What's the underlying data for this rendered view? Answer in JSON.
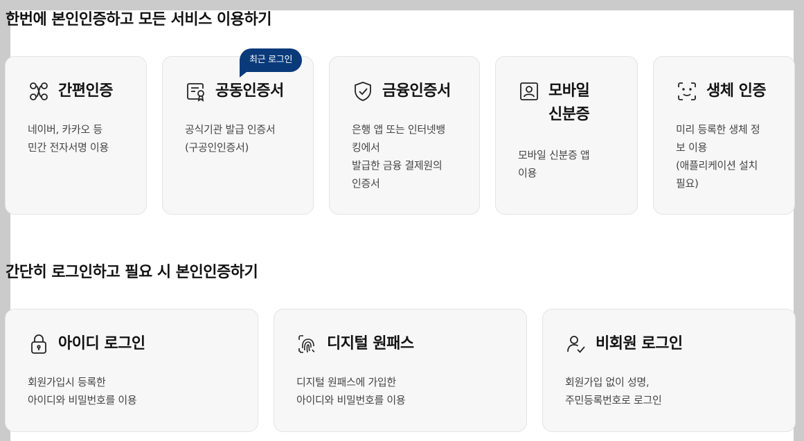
{
  "section1": {
    "title": "한번에 본인인증하고 모든 서비스 이용하기",
    "cards": [
      {
        "icon": "link-nodes-icon",
        "title_lines": [
          "간편인증"
        ],
        "desc": [
          "네이버, 카카오 등",
          "민간 전자서명 이용"
        ]
      },
      {
        "icon": "certificate-icon",
        "title_lines": [
          "공동인증서"
        ],
        "desc": [
          "공식기관 발급 인증서",
          "(구공인인증서)"
        ],
        "badge": "최근 로그인"
      },
      {
        "icon": "shield-check-icon",
        "title_lines": [
          "금융인증서"
        ],
        "desc": [
          "은행 앱 또는 인터넷뱅",
          "킹에서",
          "발급한 금융 결제원의",
          "인증서"
        ]
      },
      {
        "icon": "id-card-icon",
        "title_lines": [
          "모바일",
          "신분증"
        ],
        "desc": [
          "모바일 신분증 앱",
          "이용"
        ]
      },
      {
        "icon": "face-scan-icon",
        "title_lines": [
          "생체 인증"
        ],
        "desc": [
          "미리 등록한 생체 정",
          "보 이용",
          "(애플리케이션 설치",
          "필요)"
        ]
      }
    ]
  },
  "section2": {
    "title": "간단히 로그인하고 필요 시 본인인증하기",
    "cards": [
      {
        "icon": "lock-icon",
        "title_lines": [
          "아이디 로그인"
        ],
        "desc": [
          "회원가입시 등록한",
          "아이디와 비밀번호를 이용"
        ]
      },
      {
        "icon": "fingerprint-icon",
        "title_lines": [
          "디지털 원패스"
        ],
        "desc": [
          "디지털 원패스에 가입한",
          "아이디와 비밀번호를 이용"
        ]
      },
      {
        "icon": "user-check-icon",
        "title_lines": [
          "비회원 로그인"
        ],
        "desc": [
          "회원가입 없이 성명,",
          "주민등록번호로 로그인"
        ]
      }
    ]
  },
  "colors": {
    "badge": "#0a3a7a",
    "card_bg": "#f7f7f7",
    "card_border": "#e3e3e3",
    "page_bg": "#ffffff",
    "frame_bg": "#cbcbcb"
  }
}
